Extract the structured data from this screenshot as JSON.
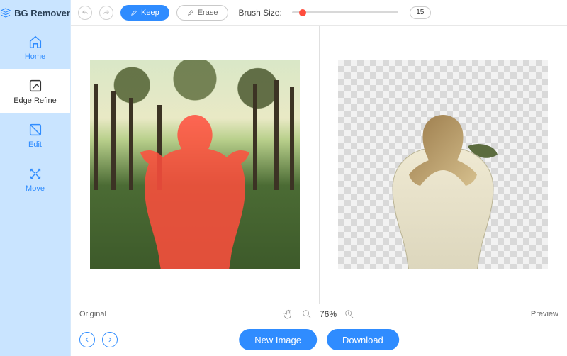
{
  "app": {
    "title": "BG Remover"
  },
  "sidebar": {
    "items": [
      {
        "label": "Home"
      },
      {
        "label": "Edge Refine"
      },
      {
        "label": "Edit"
      },
      {
        "label": "Move"
      }
    ],
    "active_index": 1
  },
  "toolbar": {
    "keep_label": "Keep",
    "erase_label": "Erase",
    "brush_label": "Brush Size:",
    "brush_value": "15",
    "slider_percent": 10
  },
  "status": {
    "original_label": "Original",
    "zoom_text": "76%",
    "preview_label": "Preview"
  },
  "actions": {
    "new_image_label": "New Image",
    "download_label": "Download"
  },
  "colors": {
    "accent": "#2f8cff",
    "mask": "#ff4d3d"
  }
}
